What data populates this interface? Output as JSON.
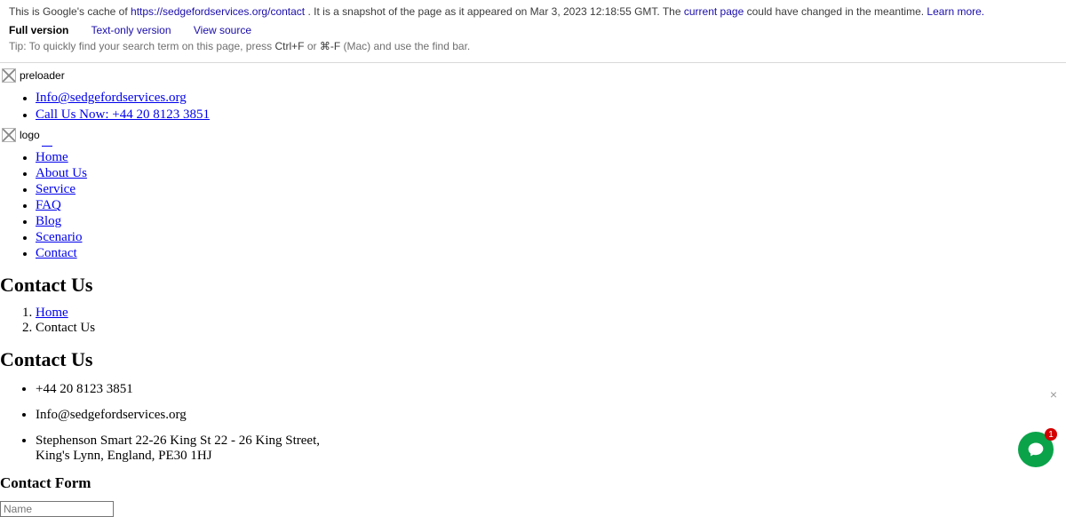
{
  "cache": {
    "intro_prefix": "This is Google's cache of ",
    "url": "https://sedgefordservices.org/contact",
    "snapshot_mid": ". It is a snapshot of the page as it appeared on Mar 3, 2023 12:18:55 GMT. The ",
    "current_page": "current page",
    "snapshot_suffix": " could have changed in the meantime. ",
    "learn_more": "Learn more.",
    "full_version": "Full version",
    "text_only": "Text-only version",
    "view_source": "View source",
    "tip_prefix": "Tip: To quickly find your search term on this page, press ",
    "ctrl_f": "Ctrl+F",
    "tip_or": " or ",
    "cmd_f": "⌘-F",
    "tip_suffix": " (Mac) and use the find bar."
  },
  "preloader_alt": "preloader",
  "top_contacts": {
    "email": "Info@sedgefordservices.org",
    "phone": "Call Us Now: +44 20 8123 3851"
  },
  "logo_alt": "logo",
  "nav": {
    "items": [
      {
        "label": "Home"
      },
      {
        "label": "About Us"
      },
      {
        "label": "Service"
      },
      {
        "label": "FAQ"
      },
      {
        "label": "Blog"
      },
      {
        "label": "Scenario"
      },
      {
        "label": "Contact"
      }
    ]
  },
  "page_title": "Contact Us",
  "breadcrumb": {
    "home": "Home",
    "current": "Contact Us"
  },
  "section_title": "Contact Us",
  "details": {
    "phone": "+44 20 8123 3851",
    "email": "Info@sedgefordservices.org",
    "address": "Stephenson Smart 22-26 King St 22 - 26 King Street, King's Lynn, England, PE30 1HJ"
  },
  "form": {
    "heading": "Contact Form",
    "name_placeholder": "Name"
  },
  "chat": {
    "close": "×",
    "badge": "1"
  }
}
